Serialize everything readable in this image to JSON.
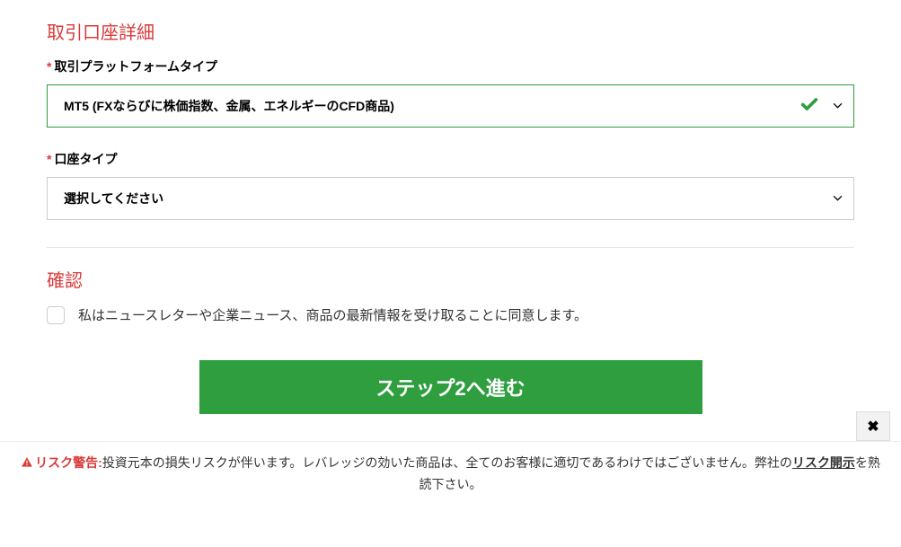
{
  "section1": {
    "title": "取引口座詳細",
    "required_mark": "*",
    "platform": {
      "label": "取引プラットフォームタイプ",
      "value": "MT5 (FXならびに株価指数、金属、エネルギーのCFD商品)"
    },
    "account_type": {
      "label": "口座タイプ",
      "placeholder": "選択してください"
    }
  },
  "section2": {
    "title": "確認",
    "checkbox_label": "私はニュースレターや企業ニュース、商品の最新情報を受け取ることに同意します。"
  },
  "button": {
    "next": "ステップ2へ進む"
  },
  "risk": {
    "label": "リスク警告:",
    "text1": "投資元本の損失リスクが伴います。レバレッジの効いた商品は、全てのお客様に適切であるわけではございません。弊社の",
    "link": "リスク開示",
    "text2": "を熟読下さい。"
  }
}
